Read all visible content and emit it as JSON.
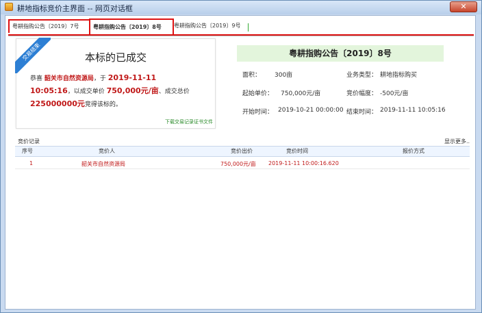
{
  "window": {
    "title": "耕地指标竞价主界面 -- 网页对话框",
    "close_label": "✕"
  },
  "tabs": [
    {
      "label": "粤耕指购公告〔2019〕7号"
    },
    {
      "label": "粤耕指购公告〔2019〕8号"
    },
    {
      "label": "粤耕指购公告〔2019〕9号"
    }
  ],
  "result": {
    "ribbon": "交易结束",
    "title": "本标的已成交",
    "line1_a": "恭喜 ",
    "buyer": "韶关市自然资源局",
    "line1_b": "，于 ",
    "date": "2019-11-11",
    "time": "10:05:16",
    "line2_a": "，以成交单价 ",
    "unit_price": "750,000元/亩",
    "line2_b": "、成交总价",
    "total": "225000000元",
    "line3": "竞得该标的。",
    "download": "下载交易记录证书文件"
  },
  "announcement": {
    "title": "粤耕指购公告〔2019〕8号",
    "area_label": "面积：",
    "area_value": "300亩",
    "type_label": "业务类型：",
    "type_value": "耕地指标购买",
    "start_price_label": "起始单价：",
    "start_price_value": "750,000元/亩",
    "step_label": "竞价幅度：",
    "step_value": "-500元/亩",
    "start_time_label": "开始时间：",
    "start_time_value": "2019-10-21 00:00:00",
    "end_time_label": "结束时间：",
    "end_time_value": "2019-11-11 10:05:16"
  },
  "records": {
    "title": "竞价记录",
    "more": "显示更多..",
    "columns": [
      "序号",
      "竞价人",
      "竞价出价",
      "竞价时间",
      "报价方式"
    ],
    "rows": [
      {
        "no": "1",
        "bidder": "韶关市自然资源局",
        "price": "750,000元/亩",
        "time": "2019-11-11 10:00:16.620",
        "method": ""
      }
    ]
  },
  "colors": {
    "accent_red": "#d11111",
    "highlight_red": "#c01818",
    "header_green": "#e3f5dc",
    "ribbon_blue": "#2d7fd4"
  }
}
